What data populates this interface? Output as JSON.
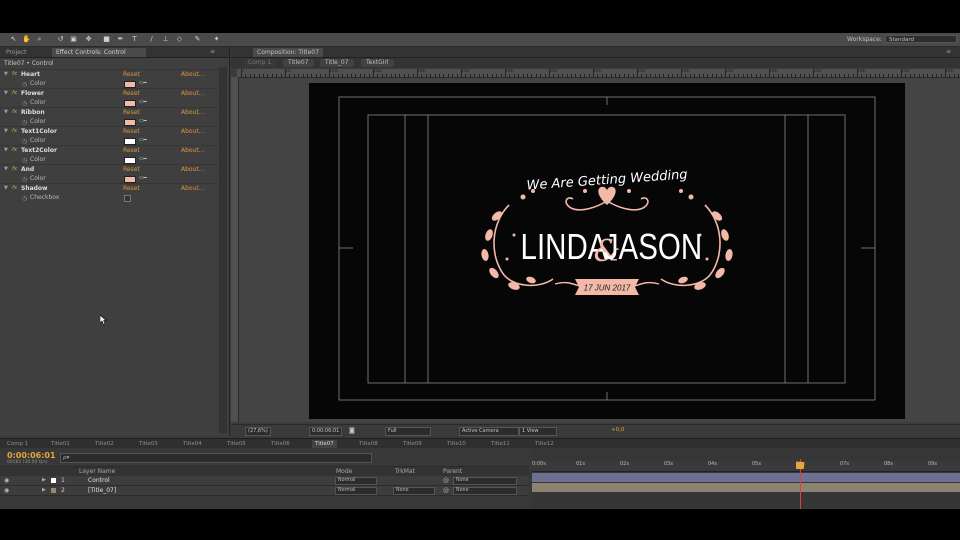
{
  "toolbar": {
    "icons": [
      "selection-tool-icon",
      "hand-tool-icon",
      "zoom-tool-icon",
      "rotate-tool-icon",
      "camera-tool-icon",
      "pan-behind-icon",
      "rectangle-tool-icon",
      "pen-tool-icon",
      "type-tool-icon",
      "brush-tool-icon",
      "clone-stamp-icon",
      "eraser-icon",
      "roto-brush-icon",
      "puppet-pin-icon"
    ],
    "workspace_label": "Workspace:",
    "workspace_value": "Standard"
  },
  "left_panel": {
    "tab_project": "Project",
    "tab_effect_controls": "Effect Controls: Control",
    "path": "Title07 • Control",
    "effects": [
      {
        "name": "Heart",
        "reset": "Reset",
        "about": "About...",
        "prop": "Color",
        "color": "#f2b9a8"
      },
      {
        "name": "Flower",
        "reset": "Reset",
        "about": "About...",
        "prop": "Color",
        "color": "#f2b9a8"
      },
      {
        "name": "Ribbon",
        "reset": "Reset",
        "about": "About...",
        "prop": "Color",
        "color": "#f2b9a8"
      },
      {
        "name": "Text1Color",
        "reset": "Reset",
        "about": "About...",
        "prop": "Color",
        "color": "#ffffff"
      },
      {
        "name": "Text2Color",
        "reset": "Reset",
        "about": "About...",
        "prop": "Color",
        "color": "#ffffff"
      },
      {
        "name": "And",
        "reset": "Reset",
        "about": "About...",
        "prop": "Color",
        "color": "#f2b9a8"
      },
      {
        "name": "Shadow",
        "reset": "Reset",
        "about": "About...",
        "prop": "Checkbox",
        "color": null
      }
    ]
  },
  "comp_panel": {
    "tab_label": "Composition: Title07",
    "crumbs": [
      "Comp 1",
      "Title07",
      "Title_07",
      "TextGirl"
    ],
    "ruler_labels": [
      "0",
      "50",
      "100",
      "150",
      "200",
      "250",
      "300",
      "350",
      "400",
      "450",
      "500",
      "550",
      "600",
      "650",
      "700",
      "750",
      "800",
      "850",
      "900"
    ],
    "artwork": {
      "tagline": "We Are Getting Wedding",
      "name1": "LINDA",
      "ampersand": "&",
      "name2": "JASON",
      "date": "17 JUN 2017"
    },
    "footer": {
      "zoom": "(27,6%)",
      "timecode": "0:00:06:01",
      "resolution": "Full",
      "camera": "Active Camera",
      "views": "1 View",
      "exposure": "+0,0"
    },
    "colors": {
      "accent_pink": "#f2b9a8",
      "text_white": "#ffffff"
    }
  },
  "timeline": {
    "tabs": [
      "Comp 1",
      "Title01",
      "Title02",
      "Title03",
      "Title04",
      "Title05",
      "Title06",
      "Title07",
      "Title08",
      "Title09",
      "Title10",
      "Title11",
      "Title12"
    ],
    "active_tab": "Title07",
    "timecode": "0:00:06:01",
    "timecode_sub": "00181 (30.00 fps)",
    "search_placeholder": "ρ▾",
    "headers": {
      "layer_name": "Layer Name",
      "mode": "Mode",
      "trkmat": "TrkMat",
      "parent": "Parent"
    },
    "layers": [
      {
        "num": "1",
        "name": "Control",
        "mode": "Normal",
        "trkmat": "",
        "parent": "None",
        "label_color": "#ffffff"
      },
      {
        "num": "2",
        "name": "[Title_07]",
        "mode": "Normal",
        "trkmat": "None",
        "parent": "None",
        "label_color": "#9a8a70"
      }
    ],
    "ruler": [
      "0:00s",
      "01s",
      "02s",
      "03s",
      "04s",
      "05s",
      "06s",
      "07s",
      "08s",
      "09s"
    ],
    "colors": {
      "playhead": "#e8a63a",
      "bar1": "#6f6f94",
      "bar2": "#8c8470"
    }
  }
}
